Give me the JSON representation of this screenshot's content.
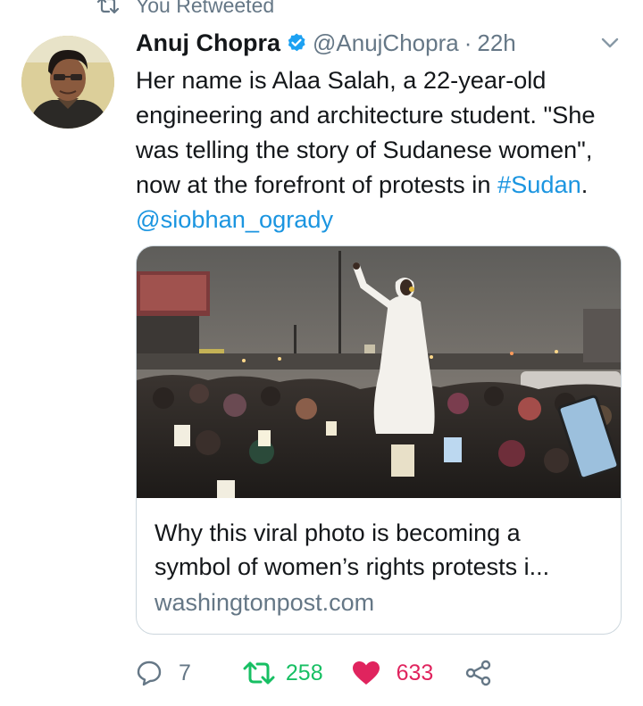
{
  "retweet_context": {
    "label": "You Retweeted"
  },
  "tweet": {
    "author": {
      "name": "Anuj Chopra",
      "handle": "@AnujChopra",
      "verified": true
    },
    "separator": "·",
    "time": "22h",
    "text": {
      "body": "Her name is Alaa Salah, a 22-year-old engineering and architecture student. \"She was telling the story of Sudanese women\", now at the forefront of protests in ",
      "hashtag": "#Sudan",
      "middle": ". ",
      "mention": "@siobhan_ogrady"
    },
    "card": {
      "title_line1": "Why this viral photo is becoming a",
      "title_line2": "symbol of women’s rights protests i...",
      "domain": "washingtonpost.com"
    },
    "actions": {
      "replies": "7",
      "retweets": "258",
      "likes": "633"
    }
  },
  "colors": {
    "link": "#1b95e0",
    "secondary": "#657786",
    "retweet_active": "#17bf63",
    "like_active": "#e0245e",
    "border": "#ccd6dd"
  },
  "icons": {
    "retweet_context": "retweet-icon",
    "verified": "verified-badge-icon",
    "caret": "chevron-down-icon",
    "reply": "reply-icon",
    "retweet": "retweet-icon",
    "like": "heart-icon",
    "share": "share-icon"
  }
}
